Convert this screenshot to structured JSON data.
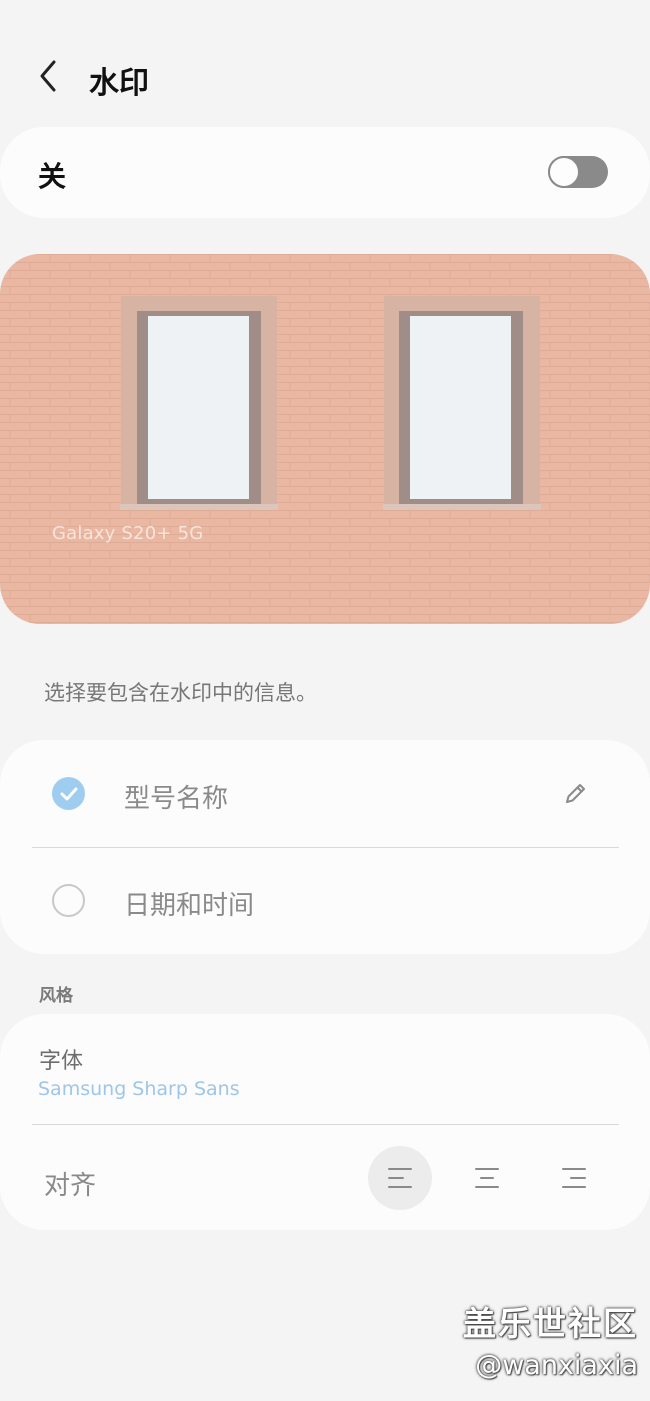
{
  "header": {
    "title": "水印",
    "back_icon": "chevron-left-icon"
  },
  "toggle": {
    "label": "关",
    "state": "off"
  },
  "preview": {
    "watermark_text": "Galaxy S20+ 5G",
    "description_colors": {
      "brick": "#e8b49e",
      "window": "#eef3f5"
    }
  },
  "hint": "选择要包含在水印中的信息。",
  "options": [
    {
      "label": "型号名称",
      "checked": true,
      "edit_icon": "pencil-icon"
    },
    {
      "label": "日期和时间",
      "checked": false
    }
  ],
  "style_section": {
    "header": "风格",
    "font_label": "字体",
    "font_value": "Samsung Sharp Sans",
    "align_label": "对齐",
    "align_options": [
      "align-left-icon",
      "align-center-icon",
      "align-right-icon"
    ],
    "align_selected": 0
  },
  "overlay": {
    "site": "盖乐世社区",
    "user": "@wanxiaxia"
  },
  "colors": {
    "accent": "#9fcdf0",
    "background": "#f4f4f4",
    "card": "#fcfcfc"
  }
}
